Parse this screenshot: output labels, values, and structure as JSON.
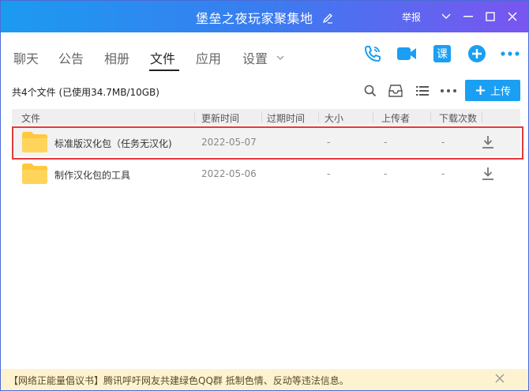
{
  "window": {
    "title": "堡垒之夜玩家聚集地",
    "report_label": "举报"
  },
  "nav": {
    "tabs": [
      {
        "label": "聊天"
      },
      {
        "label": "公告"
      },
      {
        "label": "相册"
      },
      {
        "label": "文件",
        "active": true
      },
      {
        "label": "应用"
      },
      {
        "label": "设置"
      }
    ],
    "icons": [
      "phone-icon",
      "video-icon",
      "lesson-icon",
      "add-icon",
      "more-icon"
    ],
    "lesson_label": "课"
  },
  "toolbar": {
    "summary": "共4个文件 (已使用34.7MB/10GB)",
    "upload_label": "上传"
  },
  "table": {
    "headers": {
      "name": "文件",
      "updated": "更新时间",
      "expire": "过期时间",
      "size": "大小",
      "uploader": "上传者",
      "downloads": "下载次数"
    },
    "rows": [
      {
        "name": "标准版汉化包（任务无汉化)",
        "updated": "2022-05-07",
        "expire": "",
        "size": "-",
        "uploader": "-",
        "downloads": "-",
        "selected": true
      },
      {
        "name": "制作汉化包的工具",
        "updated": "2022-05-06",
        "expire": "",
        "size": "-",
        "uploader": "-",
        "downloads": "-",
        "selected": false
      }
    ]
  },
  "footer": {
    "notice": "【网络正能量倡议书】腾讯呼吁网友共建绿色QQ群 抵制色情、反动等违法信息。"
  },
  "colors": {
    "accent": "#1a9ff2",
    "selection_border": "#e5393b",
    "folder": "#ffc83d",
    "footer_bg": "#fdf3d0"
  }
}
